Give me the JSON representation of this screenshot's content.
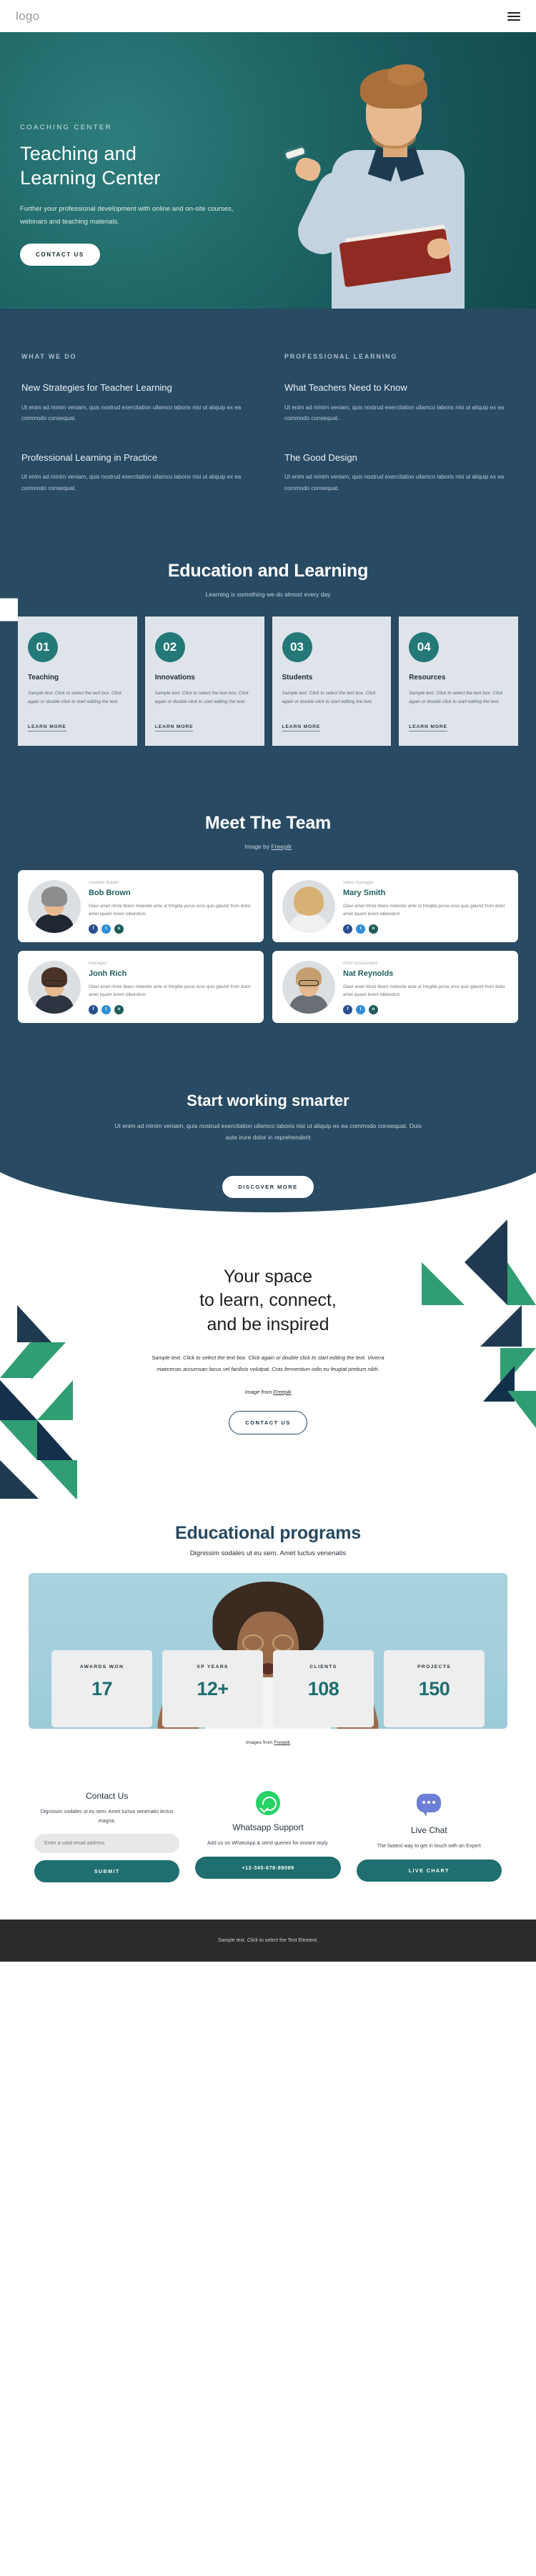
{
  "header": {
    "logo": "logo",
    "menu_icon": "hamburger-menu-icon"
  },
  "hero": {
    "eyebrow": "COACHING CENTER",
    "title_line1": "Teaching and",
    "title_line2": "Learning Center",
    "subtitle": "Further your professional development with online and on-site courses, webinars and teaching materials.",
    "cta": "CONTACT US"
  },
  "what_we_do": {
    "label": "WHAT WE DO",
    "blocks": [
      {
        "title": "New Strategies for Teacher Learning",
        "text": "Ut enim ad minim veniam, quis nostrud exercitation ullamco laboris nisi ut aliquip ex ea commodo consequat."
      },
      {
        "title": "Professional Learning in Practice",
        "text": "Ut enim ad minim veniam, quis nostrud exercitation ullamco laboris nisi ut aliquip ex ea commodo consequat."
      }
    ]
  },
  "professional_learning": {
    "label": "PROFESSIONAL LEARNING",
    "blocks": [
      {
        "title": "What Teachers Need to Know",
        "text": "Ut enim ad minim veniam, quis nostrud exercitation ullamco laboris nisi ut aliquip ex ea commodo consequat."
      },
      {
        "title": "The Good Design",
        "text": "Ut enim ad minim veniam, quis nostrud exercitation ullamco laboris nisi ut aliquip ex ea commodo consequat."
      }
    ]
  },
  "education": {
    "title": "Education and Learning",
    "subtitle": "Learning is something we do almost every day",
    "cards": [
      {
        "num": "01",
        "title": "Teaching",
        "text": "Sample text. Click to select the text box. Click again or double click to start editing the text.",
        "link": "LEARN MORE"
      },
      {
        "num": "02",
        "title": "Innovations",
        "text": "Sample text. Click to select the text box. Click again or double click to start editing the text.",
        "link": "LEARN MORE"
      },
      {
        "num": "03",
        "title": "Students",
        "text": "Sample text. Click to select the text box. Click again or double click to start editing the text.",
        "link": "LEARN MORE"
      },
      {
        "num": "04",
        "title": "Resources",
        "text": "Sample text. Click to select the text box. Click again or double click to start editing the text.",
        "link": "LEARN MORE"
      }
    ]
  },
  "team": {
    "title": "Meet The Team",
    "credit_prefix": "Image by ",
    "credit_link": "Freepik",
    "members": [
      {
        "role": "creative leader",
        "name": "Bob Brown",
        "bio": "Glavi amet ritnisl libero molestie ante ut fringilla purus eros quis glavrid from dolor amet iquam lorem bibendum"
      },
      {
        "role": "sales manager",
        "name": "Mary Smith",
        "bio": "Glavi amet ritnisl libero molestie ante ut fringilla purus eros quis glavrid from dolor amet iquam lorem bibendum"
      },
      {
        "role": "manager",
        "name": "Jonh Rich",
        "bio": "Glavi amet ritnisl libero molestie ante ut fringilla purus eros quis glavrid from dolor amet iquam lorem bibendum"
      },
      {
        "role": "chief accountant",
        "name": "Nat Reynolds",
        "bio": "Glavi amet ritnisl libero molestie ante ut fringilla purus eros quis glavrid from dolor amet iquam lorem bibendum"
      }
    ],
    "social_labels": {
      "facebook": "f",
      "twitter": "t",
      "instagram": "o"
    }
  },
  "smarter": {
    "title": "Start working smarter",
    "text": "Ut enim ad minim veniam, quis nostrud exercitation ullamco laboris nisi ut aliquip ex ea commodo consequat. Duis aute irure dolor in reprehenderit",
    "cta": "DISCOVER MORE"
  },
  "space": {
    "title_line1": "Your space",
    "title_line2": "to learn, connect,",
    "title_line3": "and be inspired",
    "text": "Sample text. Click to select the text box. Click again or double click to start editing the text. Viverra maecenas accumsan lacus vel facilisis volutpat. Cras fermentum odio eu feugiat pretium nibh.",
    "credit_prefix": "Image from ",
    "credit_link": "Freepik",
    "cta": "CONTACT US"
  },
  "programs": {
    "title": "Educational programs",
    "subtitle": "Dignissim sodales ut eu sem. Amet luctus venenatis",
    "stats": [
      {
        "label": "AWARDS WON",
        "value": "17"
      },
      {
        "label": "XP YEARS",
        "value": "12+"
      },
      {
        "label": "CLIENTS",
        "value": "108"
      },
      {
        "label": "PROJECTS",
        "value": "150"
      }
    ],
    "credit_prefix": "Images from ",
    "credit_link": "Freepik"
  },
  "contact": {
    "form": {
      "title": "Contact Us",
      "text": "Dignissim sodales ut eu sem. Amet luctus venenatis lectus magna.",
      "placeholder": "Enter a valid email address",
      "submit": "SUBMIT"
    },
    "whatsapp": {
      "icon": "whatsapp-icon",
      "title": "Whatsapp Support",
      "text": "Add us on WhatsApp & send queries for instant reply.",
      "cta": "+12-345-678-89089"
    },
    "livechat": {
      "icon": "chat-bubble-icon",
      "title": "Live Chat",
      "text": "The fastest way to get in touch with an Expert",
      "cta": "LIVE CHART"
    }
  },
  "footer": {
    "text": "Sample text. Click to select the Text Element."
  },
  "colors": {
    "teal": "#1f6e70",
    "navy": "#284a63",
    "hero_green": "#1f6767",
    "card_grey": "#dfe4ea"
  }
}
